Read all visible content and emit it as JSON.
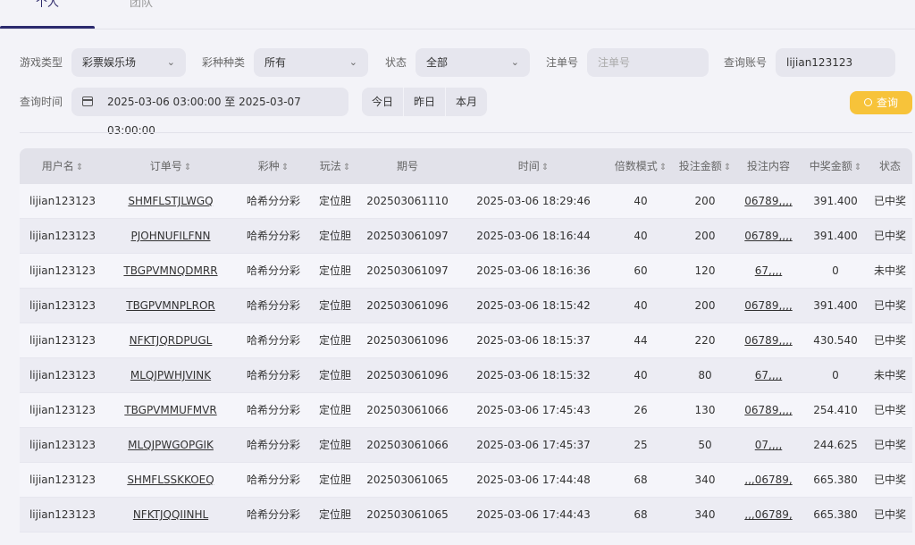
{
  "tabs": [
    {
      "label": "个人"
    },
    {
      "label": "团队"
    }
  ],
  "filters": {
    "game_type_label": "游戏类型",
    "game_type_value": "彩票娱乐场",
    "lottery_type_label": "彩种种类",
    "lottery_type_value": "所有",
    "status_label": "状态",
    "status_value": "全部",
    "order_no_label": "注单号",
    "order_no_placeholder": "注单号",
    "account_label": "查询账号",
    "account_value": "lijian123123",
    "time_label": "查询时间",
    "time_value": "2025-03-06 03:00:00 至 2025-03-07 03:00:00",
    "today": "今日",
    "yesterday": "昨日",
    "month": "本月",
    "search_button": "查询"
  },
  "table": {
    "headers": {
      "user": "用户名",
      "order": "订单号",
      "lottery": "彩种",
      "play": "玩法",
      "period": "期号",
      "time": "时间",
      "multiplier": "倍数模式",
      "amount": "投注金额",
      "content": "投注内容",
      "prize": "中奖金额",
      "status": "状态"
    },
    "rows": [
      {
        "user": "lijian123123",
        "order": "SHMFLSTJLWGQ",
        "lottery": "哈希分分彩",
        "play": "定位胆",
        "period": "202503061110",
        "time": "2025-03-06 18:29:46",
        "multiplier": "40",
        "amount": "200",
        "content": "06789,,,,",
        "prize": "391.400",
        "status": "已中奖"
      },
      {
        "user": "lijian123123",
        "order": "PJOHNUFILFNN",
        "lottery": "哈希分分彩",
        "play": "定位胆",
        "period": "202503061097",
        "time": "2025-03-06 18:16:44",
        "multiplier": "40",
        "amount": "200",
        "content": "06789,,,,",
        "prize": "391.400",
        "status": "已中奖"
      },
      {
        "user": "lijian123123",
        "order": "TBGPVMNQDMRR",
        "lottery": "哈希分分彩",
        "play": "定位胆",
        "period": "202503061097",
        "time": "2025-03-06 18:16:36",
        "multiplier": "60",
        "amount": "120",
        "content": "67,,,,",
        "prize": "0",
        "status": "未中奖"
      },
      {
        "user": "lijian123123",
        "order": "TBGPVMNPLROR",
        "lottery": "哈希分分彩",
        "play": "定位胆",
        "period": "202503061096",
        "time": "2025-03-06 18:15:42",
        "multiplier": "40",
        "amount": "200",
        "content": "06789,,,,",
        "prize": "391.400",
        "status": "已中奖"
      },
      {
        "user": "lijian123123",
        "order": "NFKTJQRDPUGL",
        "lottery": "哈希分分彩",
        "play": "定位胆",
        "period": "202503061096",
        "time": "2025-03-06 18:15:37",
        "multiplier": "44",
        "amount": "220",
        "content": "06789,,,,",
        "prize": "430.540",
        "status": "已中奖"
      },
      {
        "user": "lijian123123",
        "order": "MLQJPWHJVINK",
        "lottery": "哈希分分彩",
        "play": "定位胆",
        "period": "202503061096",
        "time": "2025-03-06 18:15:32",
        "multiplier": "40",
        "amount": "80",
        "content": "67,,,,",
        "prize": "0",
        "status": "未中奖"
      },
      {
        "user": "lijian123123",
        "order": "TBGPVMMUFMVR",
        "lottery": "哈希分分彩",
        "play": "定位胆",
        "period": "202503061066",
        "time": "2025-03-06 17:45:43",
        "multiplier": "26",
        "amount": "130",
        "content": "06789,,,,",
        "prize": "254.410",
        "status": "已中奖"
      },
      {
        "user": "lijian123123",
        "order": "MLQJPWGOPGIK",
        "lottery": "哈希分分彩",
        "play": "定位胆",
        "period": "202503061066",
        "time": "2025-03-06 17:45:37",
        "multiplier": "25",
        "amount": "50",
        "content": "07,,,,",
        "prize": "244.625",
        "status": "已中奖"
      },
      {
        "user": "lijian123123",
        "order": "SHMFLSSKKOEQ",
        "lottery": "哈希分分彩",
        "play": "定位胆",
        "period": "202503061065",
        "time": "2025-03-06 17:44:48",
        "multiplier": "68",
        "amount": "340",
        "content": ",,,06789,",
        "prize": "665.380",
        "status": "已中奖"
      },
      {
        "user": "lijian123123",
        "order": "NFKTJQQIINHL",
        "lottery": "哈希分分彩",
        "play": "定位胆",
        "period": "202503061065",
        "time": "2025-03-06 17:44:43",
        "multiplier": "68",
        "amount": "340",
        "content": ",,,06789,",
        "prize": "665.380",
        "status": "已中奖"
      }
    ]
  }
}
